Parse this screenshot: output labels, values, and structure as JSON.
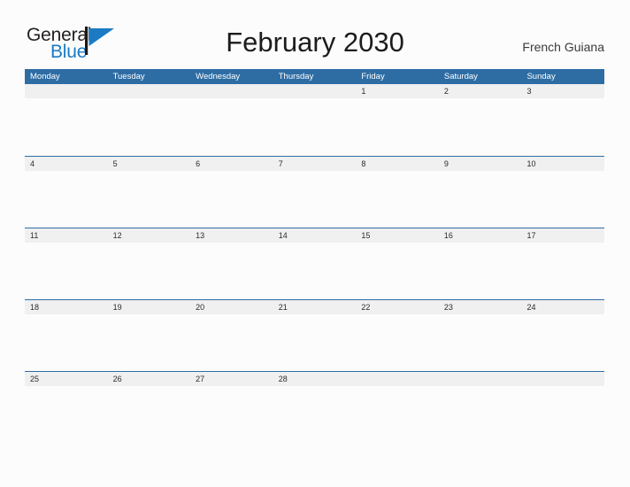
{
  "brand": {
    "name_part1": "General",
    "name_part2": "Blue",
    "flag_icon": "blue-triangle-flag",
    "color_primary": "#1a7bc4",
    "color_text": "#231f20"
  },
  "header": {
    "title": "February 2030",
    "location": "French Guiana"
  },
  "calendar": {
    "header_color": "#2e6da4",
    "band_color": "#f0f0f0",
    "weekdays": [
      "Monday",
      "Tuesday",
      "Wednesday",
      "Thursday",
      "Friday",
      "Saturday",
      "Sunday"
    ],
    "weeks": [
      {
        "bordered": false,
        "days": [
          "",
          "",
          "",
          "",
          "1",
          "2",
          "3"
        ]
      },
      {
        "bordered": true,
        "days": [
          "4",
          "5",
          "6",
          "7",
          "8",
          "9",
          "10"
        ]
      },
      {
        "bordered": true,
        "days": [
          "11",
          "12",
          "13",
          "14",
          "15",
          "16",
          "17"
        ]
      },
      {
        "bordered": true,
        "days": [
          "18",
          "19",
          "20",
          "21",
          "22",
          "23",
          "24"
        ]
      },
      {
        "bordered": true,
        "days": [
          "25",
          "26",
          "27",
          "28",
          "",
          "",
          ""
        ]
      }
    ]
  }
}
